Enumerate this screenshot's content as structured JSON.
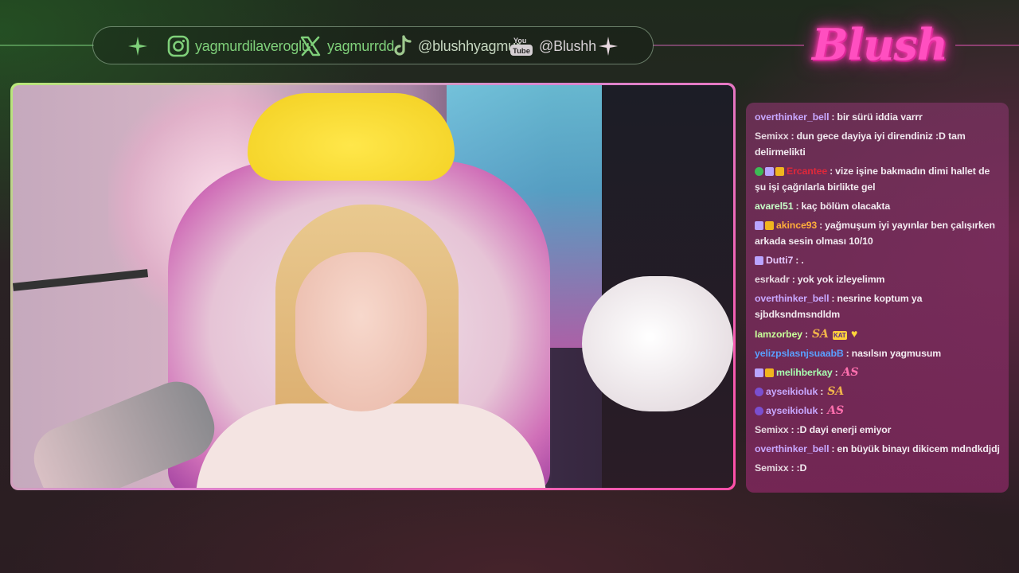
{
  "socials": {
    "instagram": {
      "icon": "instagram-icon",
      "handle": "yagmurdilaveroglu"
    },
    "x": {
      "icon": "x-icon",
      "handle": "yagmurrdd"
    },
    "tiktok": {
      "icon": "tiktok-icon",
      "handle": "@blushhyagmur"
    },
    "youtube": {
      "icon": "youtube-icon",
      "handle": "@Blushh"
    }
  },
  "logo": {
    "text": "Blush"
  },
  "colors": {
    "accent_green": "#7fd07a",
    "accent_pink": "#ff4fc0",
    "chat_bg": "#7a3260"
  },
  "chat": {
    "messages": [
      {
        "user": "overthinker_bell",
        "color": "#c8a8ff",
        "badges": [],
        "text": "bir sürü iddia varrr"
      },
      {
        "user": "Semixx",
        "color": "#e6d8e0",
        "badges": [],
        "text": "dun gece dayiya iyi direndiniz :D tam delirmelikti"
      },
      {
        "user": "Ercantee",
        "color": "#e0283a",
        "badges": [
          "verified",
          "gift",
          "crown"
        ],
        "text": "vize işine bakmadın dimi hallet de şu işi çağrılarla birlikte gel"
      },
      {
        "user": "avarel51",
        "color": "#c8ffc8",
        "badges": [],
        "text": "kaç bölüm olacakta"
      },
      {
        "user": "akince93",
        "color": "#ffae3a",
        "badges": [
          "gift",
          "crown"
        ],
        "text": "yağmuşum iyi yayınlar ben çalışırken arkada sesin olması 10/10"
      },
      {
        "user": "Dutti7",
        "color": "#e6c8ff",
        "badges": [
          "gift"
        ],
        "text": "."
      },
      {
        "user": "esrkadr",
        "color": "#e6d8e0",
        "badges": [],
        "text": "yok yok izleyelimm"
      },
      {
        "user": "overthinker_bell",
        "color": "#c8a8ff",
        "badges": [],
        "text": "nesrine koptum ya sjbdksndmsndldm"
      },
      {
        "user": "Iamzorbey",
        "color": "#c8ff9a",
        "badges": [],
        "text": "",
        "emotes": [
          "SA",
          "KAT",
          "heart"
        ]
      },
      {
        "user": "yelizpslasnjsuaabB",
        "color": "#5aa0ff",
        "badges": [],
        "text": "nasılsın yagmusum"
      },
      {
        "user": "melihberkay",
        "color": "#a8ffb0",
        "badges": [
          "gift",
          "crown"
        ],
        "text": "",
        "emotes": [
          "AS"
        ]
      },
      {
        "user": "ayseikioluk",
        "color": "#c8a8ff",
        "badges": [
          "sub"
        ],
        "text": "",
        "emotes": [
          "SA"
        ]
      },
      {
        "user": "ayseikioluk",
        "color": "#c8a8ff",
        "badges": [
          "sub"
        ],
        "text": "",
        "emotes": [
          "AS"
        ]
      },
      {
        "user": "Semixx",
        "color": "#e6d8e0",
        "badges": [],
        "text": ":D dayi enerji emiyor"
      },
      {
        "user": "overthinker_bell",
        "color": "#c8a8ff",
        "badges": [],
        "text": "en büyük binayı dikicem mdndkdjdj"
      },
      {
        "user": "Semixx",
        "color": "#e6d8e0",
        "badges": [],
        "text": ":D"
      }
    ]
  }
}
